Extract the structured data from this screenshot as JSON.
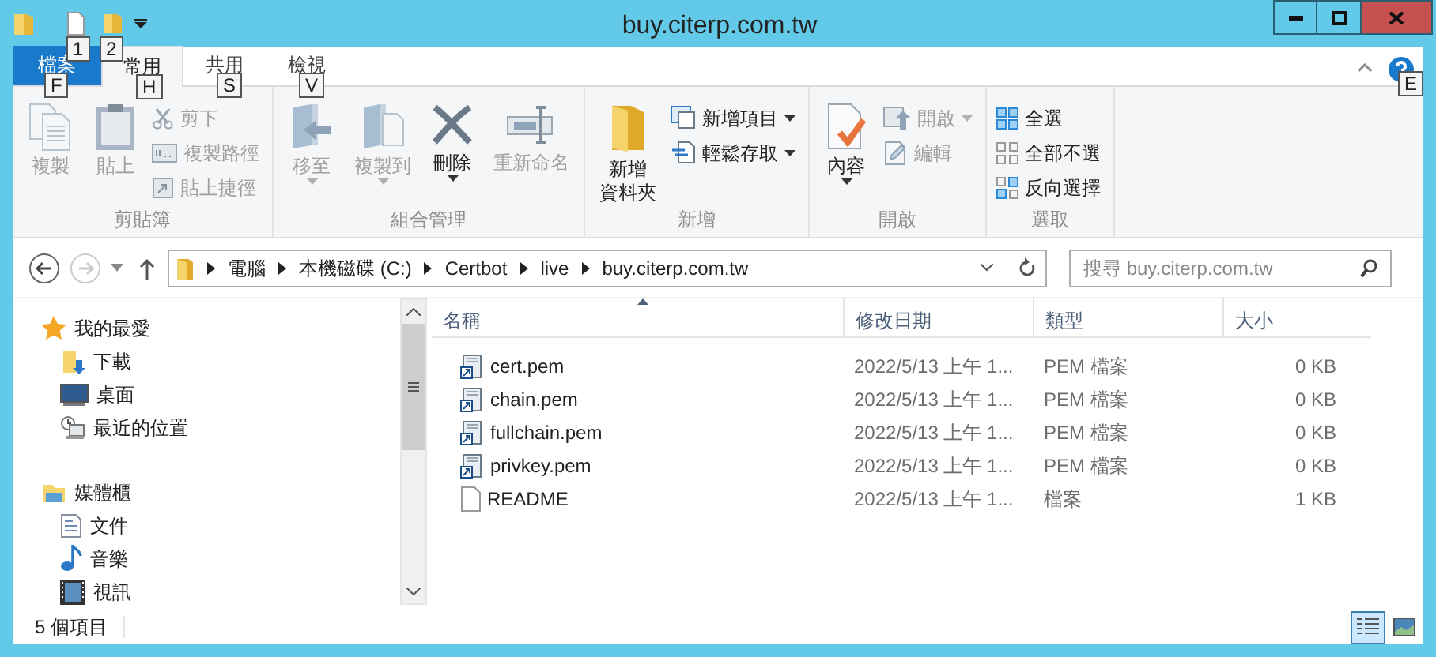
{
  "window": {
    "title": "buy.citerp.com.tw",
    "quick_access_keytips": [
      "1",
      "2"
    ]
  },
  "tabs": [
    {
      "label": "檔案",
      "kind": "file",
      "keytip": "F",
      "selected": false
    },
    {
      "label": "常用",
      "kind": "tab",
      "keytip": "H",
      "selected": true
    },
    {
      "label": "共用",
      "kind": "tab",
      "keytip": "S",
      "selected": false
    },
    {
      "label": "檢視",
      "kind": "tab",
      "keytip": "V",
      "selected": false
    }
  ],
  "help_keytip": "E",
  "ribbon": [
    {
      "label": "剪貼簿",
      "items": [
        {
          "kind": "large",
          "label": "複製",
          "disabled": true,
          "dropdown": false
        },
        {
          "kind": "large",
          "label": "貼上",
          "disabled": true,
          "dropdown": false
        },
        {
          "kind": "small",
          "label": "剪下",
          "disabled": true,
          "dropdown": false
        },
        {
          "kind": "small",
          "label": "複製路徑",
          "disabled": true,
          "dropdown": false
        },
        {
          "kind": "small",
          "label": "貼上捷徑",
          "disabled": true,
          "dropdown": false
        }
      ]
    },
    {
      "label": "組合管理",
      "items": [
        {
          "kind": "large",
          "label": "移至",
          "disabled": true,
          "dropdown": true
        },
        {
          "kind": "large",
          "label": "複製到",
          "disabled": true,
          "dropdown": true
        },
        {
          "kind": "large",
          "label": "刪除",
          "disabled": false,
          "dropdown": true
        },
        {
          "kind": "large",
          "label": "重新命名",
          "disabled": true,
          "dropdown": false
        }
      ]
    },
    {
      "label": "新增",
      "items": [
        {
          "kind": "large",
          "label": "新增資料夾",
          "disabled": false,
          "dropdown": false
        },
        {
          "kind": "small",
          "label": "新增項目",
          "disabled": false,
          "dropdown": true
        },
        {
          "kind": "small",
          "label": "輕鬆存取",
          "disabled": false,
          "dropdown": true
        }
      ]
    },
    {
      "label": "開啟",
      "items": [
        {
          "kind": "large",
          "label": "內容",
          "disabled": false,
          "dropdown": true
        },
        {
          "kind": "small",
          "label": "開啟",
          "disabled": true,
          "dropdown": true
        },
        {
          "kind": "small",
          "label": "編輯",
          "disabled": true,
          "dropdown": false
        }
      ]
    },
    {
      "label": "選取",
      "items": [
        {
          "kind": "small",
          "label": "全選",
          "disabled": false,
          "dropdown": false
        },
        {
          "kind": "small",
          "label": "全部不選",
          "disabled": false,
          "dropdown": false
        },
        {
          "kind": "small",
          "label": "反向選擇",
          "disabled": false,
          "dropdown": false
        }
      ]
    }
  ],
  "nav": {
    "back_disabled": false,
    "forward_disabled": true,
    "breadcrumbs": [
      "電腦",
      "本機磁碟 (C:)",
      "Certbot",
      "live",
      "buy.citerp.com.tw"
    ],
    "search": {
      "placeholder": "搜尋 buy.citerp.com.tw"
    }
  },
  "sidebar": {
    "items": [
      {
        "label": "我的最愛",
        "children": [
          {
            "label": "下載"
          },
          {
            "label": "桌面"
          },
          {
            "label": "最近的位置"
          }
        ]
      },
      {
        "label": "媒體櫃",
        "children": [
          {
            "label": "文件"
          },
          {
            "label": "音樂"
          },
          {
            "label": "視訊"
          }
        ]
      }
    ]
  },
  "table": {
    "columns": [
      {
        "label": "名稱",
        "sorted": true
      },
      {
        "label": "修改日期",
        "sorted": false
      },
      {
        "label": "類型",
        "sorted": false
      },
      {
        "label": "大小",
        "sorted": false
      }
    ],
    "rows": [
      {
        "kind": "shortcut",
        "cells": [
          "cert.pem",
          "2022/5/13 上午 1...",
          "PEM 檔案",
          "0 KB"
        ]
      },
      {
        "kind": "shortcut",
        "cells": [
          "chain.pem",
          "2022/5/13 上午 1...",
          "PEM 檔案",
          "0 KB"
        ]
      },
      {
        "kind": "shortcut",
        "cells": [
          "fullchain.pem",
          "2022/5/13 上午 1...",
          "PEM 檔案",
          "0 KB"
        ]
      },
      {
        "kind": "shortcut",
        "cells": [
          "privkey.pem",
          "2022/5/13 上午 1...",
          "PEM 檔案",
          "0 KB"
        ]
      },
      {
        "kind": "file",
        "cells": [
          "README",
          "2022/5/13 上午 1...",
          "檔案",
          "1 KB"
        ]
      }
    ]
  },
  "status_bar": {
    "text": "5 個項目",
    "views": [
      {
        "kind": "details",
        "selected": true
      },
      {
        "kind": "large_icons",
        "selected": false
      }
    ]
  }
}
